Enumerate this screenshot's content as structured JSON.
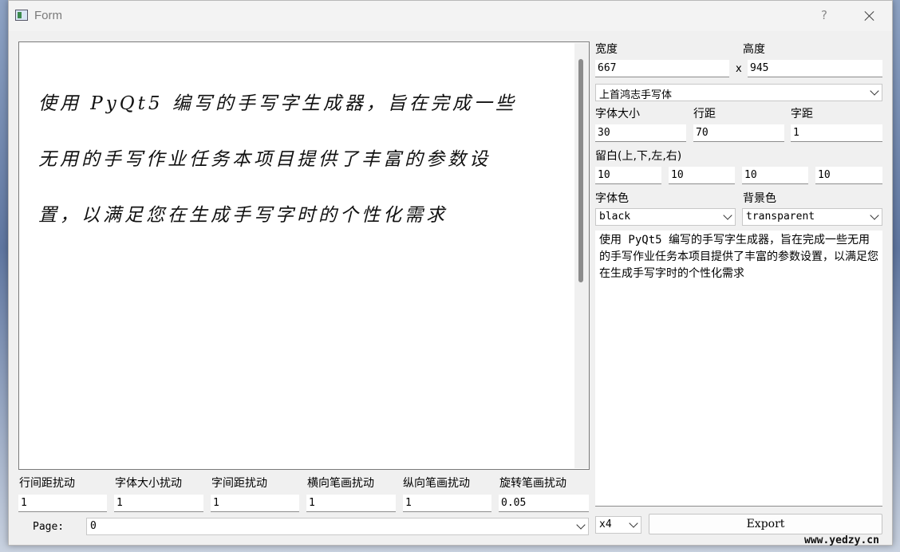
{
  "window": {
    "title": "Form",
    "help_label": "?"
  },
  "preview": {
    "text": "使用 PyQt5 编写的手写字生成器，旨在完成一些\n无用的手写作业任务本项目提供了丰富的参数设\n置，以满足您在生成手写字时的个性化需求"
  },
  "disturb": {
    "labels": [
      "行间距扰动",
      "字体大小扰动",
      "字间距扰动",
      "横向笔画扰动",
      "纵向笔画扰动",
      "旋转笔画扰动"
    ],
    "values": [
      "1",
      "1",
      "1",
      "1",
      "1",
      "0.05"
    ]
  },
  "page": {
    "label": "Page:",
    "value": "0"
  },
  "size": {
    "width_label": "宽度",
    "height_label": "高度",
    "width": "667",
    "x_label": "x",
    "height": "945"
  },
  "font": {
    "selected": "上首鸿志手写体"
  },
  "spacing": {
    "font_size_label": "字体大小",
    "line_spacing_label": "行距",
    "char_spacing_label": "字距",
    "font_size": "30",
    "line_spacing": "70",
    "char_spacing": "1"
  },
  "margins": {
    "label": "留白(上,下,左,右)",
    "values": [
      "10",
      "10",
      "10",
      "10"
    ]
  },
  "colors": {
    "font_color_label": "字体色",
    "bg_color_label": "背景色",
    "font_color": "black",
    "bg_color": "transparent"
  },
  "input": {
    "text": "使用 PyQt5 编写的手写字生成器，旨在完成一些无用的手写作业任务本项目提供了丰富的参数设置，以满足您在生成手写字时的个性化需求"
  },
  "export": {
    "scale": "x4",
    "button_label": "Export"
  },
  "watermark": "www.yedzy.cn"
}
